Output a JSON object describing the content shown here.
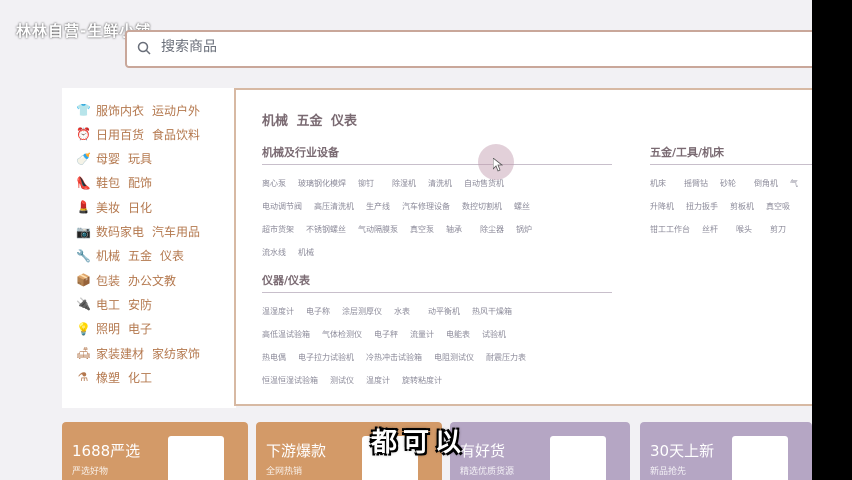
{
  "header": {
    "brand_text": "林林自营-生鲜小铺"
  },
  "search": {
    "placeholder": "搜索商品"
  },
  "categories": [
    {
      "icon": "shirt-icon",
      "glyph": "👕",
      "links": [
        "服饰内衣",
        "运动户外"
      ]
    },
    {
      "icon": "alarm-clock-icon",
      "glyph": "⏰",
      "links": [
        "日用百货",
        "食品饮料"
      ]
    },
    {
      "icon": "bottle-icon",
      "glyph": "🍼",
      "links": [
        "母婴",
        "玩具"
      ]
    },
    {
      "icon": "shoe-icon",
      "glyph": "👠",
      "links": [
        "鞋包",
        "配饰"
      ]
    },
    {
      "icon": "lipstick-icon",
      "glyph": "💄",
      "links": [
        "美妆",
        "日化"
      ]
    },
    {
      "icon": "camera-icon",
      "glyph": "📷",
      "links": [
        "数码家电",
        "汽车用品"
      ]
    },
    {
      "icon": "wrench-icon",
      "glyph": "🔧",
      "links": [
        "机械",
        "五金",
        "仪表"
      ]
    },
    {
      "icon": "box-icon",
      "glyph": "📦",
      "links": [
        "包装",
        "办公文教"
      ]
    },
    {
      "icon": "plug-icon",
      "glyph": "🔌",
      "links": [
        "电工",
        "安防"
      ]
    },
    {
      "icon": "bulb-icon",
      "glyph": "💡",
      "links": [
        "照明",
        "电子"
      ]
    },
    {
      "icon": "sofa-icon",
      "glyph": "🛋",
      "links": [
        "家装建材",
        "家纺家饰"
      ]
    },
    {
      "icon": "flask-icon",
      "glyph": "⚗",
      "links": [
        "橡塑",
        "化工"
      ]
    }
  ],
  "mega_menu": {
    "title": "机械 五金 仪表",
    "sections": [
      {
        "heading": "机械及行业设备",
        "rows": [
          [
            "离心泵",
            "玻璃钢化模焊",
            "铆钉",
            "除湿机",
            "清洗机",
            "自动售货机"
          ],
          [
            "电动调节阀",
            "高压清洗机",
            "生产线",
            "汽车修理设备",
            "数控切割机",
            "螺丝"
          ],
          [
            "超市货架",
            "不锈钢螺丝",
            "气动隔膜泵",
            "真空泵",
            "轴承",
            "除尘器",
            "锅炉"
          ],
          [
            "流水线",
            "机械"
          ]
        ]
      },
      {
        "heading": "仪器/仪表",
        "rows": [
          [
            "温湿度计",
            "电子称",
            "涂层测厚仪",
            "水表",
            "动平衡机",
            "热风干燥箱"
          ],
          [
            "高低温试验箱",
            "气体检测仪",
            "电子秤",
            "流量计",
            "电能表",
            "试验机"
          ],
          [
            "热电偶",
            "电子拉力试验机",
            "冷热冲击试验箱",
            "电阻测试仪",
            "耐震压力表"
          ],
          [
            "恒温恒湿试验箱",
            "测试仪",
            "温度计",
            "旋转粘度计"
          ]
        ]
      },
      {
        "heading": "五金/工具/机床",
        "rows": [
          [
            "机床",
            "摇臂钻",
            "砂轮",
            "倒角机",
            "气"
          ],
          [
            "升降机",
            "扭力扳手",
            "剪板机",
            "真空吸"
          ],
          [
            "钳工工作台",
            "丝杆",
            "喉头",
            "剪刀"
          ]
        ]
      }
    ]
  },
  "banners": [
    {
      "title": "1688严选",
      "subtitle": "严选好物",
      "color": "#d39a68"
    },
    {
      "title": "下游爆款",
      "subtitle": "全网热销",
      "color": "#d39a68"
    },
    {
      "title": "有好货",
      "subtitle": "精选优质货源",
      "color": "#b5a6c4"
    },
    {
      "title": "30天上新",
      "subtitle": "新品抢先",
      "color": "#b5a6c4"
    }
  ],
  "caption": "都可以"
}
